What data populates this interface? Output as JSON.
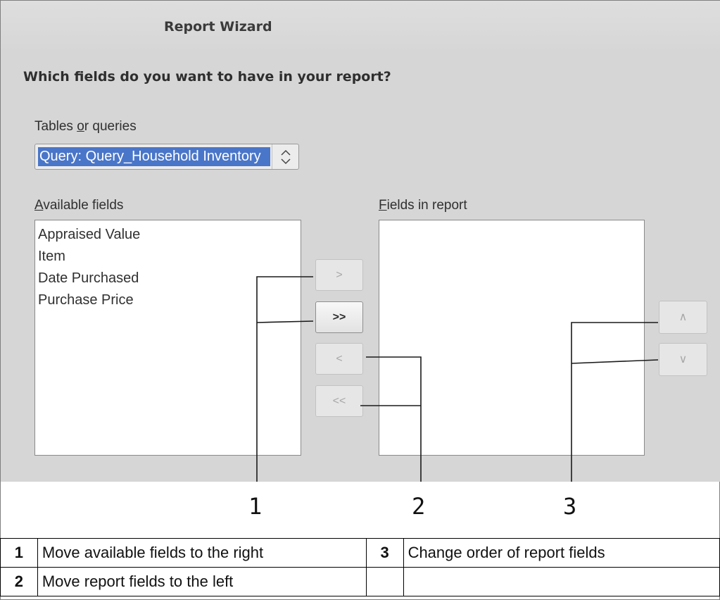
{
  "dialog": {
    "title": "Report Wizard",
    "question": "Which fields do you want to have in your report?",
    "tables_label_pre": "Tables ",
    "tables_label_key": "o",
    "tables_label_post": "r queries",
    "selected_query": "Query: Query_Household Inventory",
    "available_label_key": "A",
    "available_label_post": "vailable fields",
    "report_label_key": "F",
    "report_label_post": "ields in report",
    "available_fields": [
      "Appraised Value",
      "Item",
      "Date Purchased",
      "Purchase Price"
    ],
    "report_fields": [],
    "buttons": {
      "add": ">",
      "add_all": ">>",
      "remove": "<",
      "remove_all": "<<",
      "move_up": "∧",
      "move_down": "∨"
    }
  },
  "callouts": [
    "1",
    "2",
    "3"
  ],
  "legend": [
    {
      "number": "1",
      "text": "Move available fields to the right"
    },
    {
      "number": "3",
      "text": "Change order of report fields"
    },
    {
      "number": "2",
      "text": "Move report fields to the left"
    },
    {
      "number": "",
      "text": ""
    }
  ],
  "colors": {
    "dialog_bg": "#d6d6d6",
    "selection": "#4a76c9"
  }
}
